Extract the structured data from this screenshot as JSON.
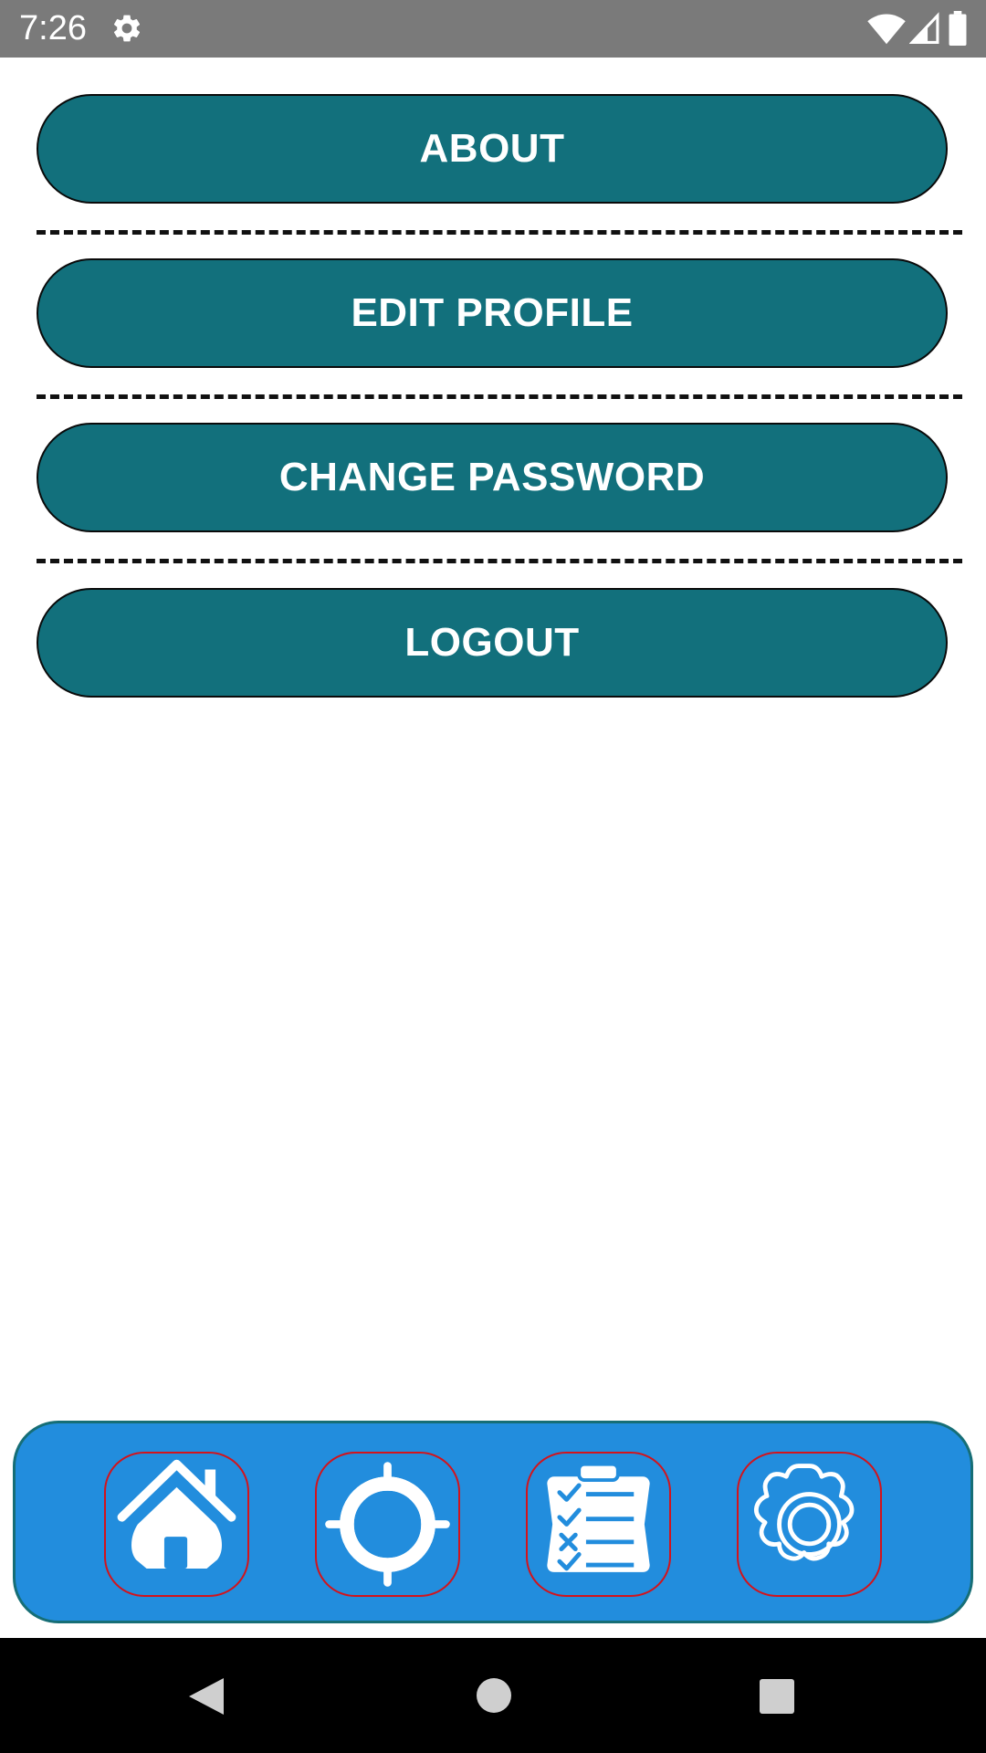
{
  "status_bar": {
    "time": "7:26",
    "icons": [
      "settings-gear-icon",
      "wifi-icon",
      "cell-signal-icon",
      "battery-icon"
    ]
  },
  "menu": {
    "items": [
      {
        "label": "ABOUT"
      },
      {
        "label": "EDIT PROFILE"
      },
      {
        "label": "CHANGE PASSWORD"
      },
      {
        "label": "LOGOUT"
      }
    ]
  },
  "bottom_nav": {
    "items": [
      {
        "icon": "home-icon"
      },
      {
        "icon": "crosshair-icon"
      },
      {
        "icon": "checklist-icon"
      },
      {
        "icon": "settings-icon"
      }
    ]
  },
  "system_nav": {
    "buttons": [
      "back-icon",
      "home-circle-icon",
      "recents-icon"
    ]
  },
  "colors": {
    "status_bar": "#7a7a7a",
    "menu_button": "#12707c",
    "bottom_nav_bg": "#228ddd",
    "bottom_nav_border": "#166e76",
    "nav_item_border": "#d3131b",
    "system_nav_bg": "#000000"
  }
}
